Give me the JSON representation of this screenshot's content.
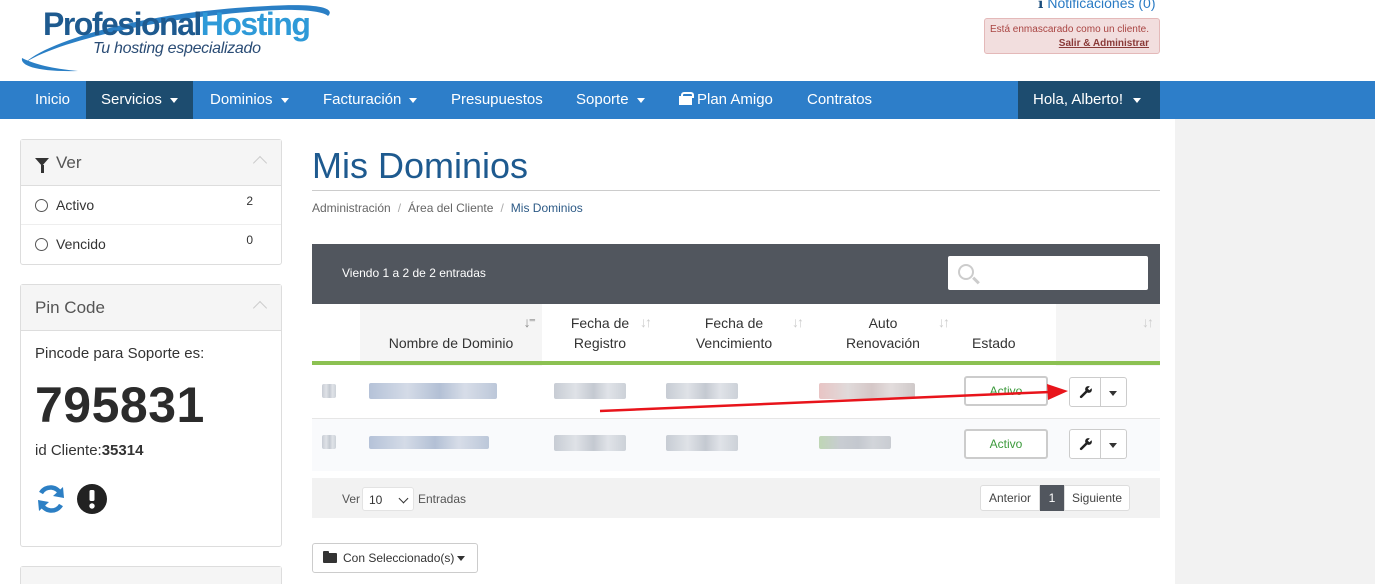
{
  "brand": {
    "name_part1": "Profesional",
    "name_part2": "Hosting",
    "tagline": "Tu hosting especializado"
  },
  "header": {
    "notifications": "Notificaciones (0)",
    "masquerade_text": "Está enmascarado como un cliente.",
    "masquerade_link": "Salir & Administrar"
  },
  "nav": {
    "inicio": "Inicio",
    "servicios": "Servicios",
    "dominios": "Dominios",
    "facturacion": "Facturación",
    "presupuestos": "Presupuestos",
    "soporte": "Soporte",
    "plan_amigo": "Plan Amigo",
    "contratos": "Contratos",
    "user": "Hola, Alberto!"
  },
  "sidebar": {
    "filter_title": "Ver",
    "filters": [
      {
        "label": "Activo",
        "count": "2"
      },
      {
        "label": "Vencido",
        "count": "0"
      }
    ],
    "pin": {
      "title": "Pin Code",
      "label": "Pincode para Soporte es:",
      "code": "795831",
      "client_label": "id Cliente:",
      "client_id": "35314"
    }
  },
  "page": {
    "title": "Mis Dominios",
    "breadcrumb": [
      "Administración",
      "Área del Cliente",
      "Mis Dominios"
    ]
  },
  "table": {
    "info": "Viendo 1 a 2 de 2 entradas",
    "columns": {
      "domain": "Nombre de Dominio",
      "reg_1": "Fecha de",
      "reg_2": "Registro",
      "exp_1": "Fecha de",
      "exp_2": "Vencimiento",
      "auto_1": "Auto",
      "auto_2": "Renovación",
      "status": "Estado"
    },
    "rows": [
      {
        "status": "Activo"
      },
      {
        "status": "Activo"
      }
    ],
    "footer": {
      "show": "Ver",
      "page_size": "10",
      "entries": "Entradas",
      "prev": "Anterior",
      "page": "1",
      "next": "Siguiente"
    },
    "bulk_action": "Con Seleccionado(s)"
  },
  "colors": {
    "nav": "#2d7ec9",
    "nav_active": "#1d4c6f",
    "title": "#1e5a8f",
    "table_header": "#51565e",
    "accent_green": "#8cc152",
    "annotation_arrow": "#e8141b"
  }
}
